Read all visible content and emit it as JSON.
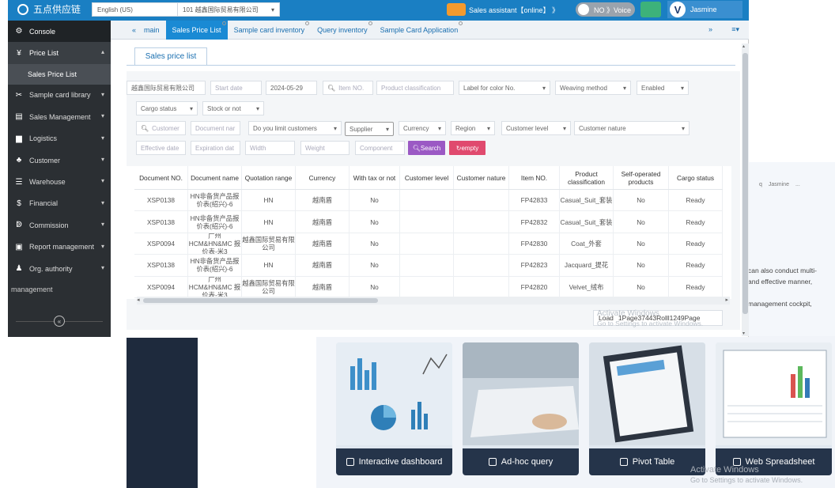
{
  "background": {
    "top_right": [
      "q",
      "Jasmine",
      "..."
    ],
    "text_lines": [
      "can also conduct multi-",
      "and effective manner,",
      "management cockpit,"
    ],
    "cards": [
      {
        "label": "Interactive dashboard",
        "icon": "dashboard-icon"
      },
      {
        "label": "Ad-hoc query",
        "icon": "query-icon"
      },
      {
        "label": "Pivot Table",
        "icon": "pivot-icon"
      },
      {
        "label": "Web Spreadsheet",
        "icon": "spreadsheet-icon"
      }
    ],
    "activate_title": "Activate Windows",
    "activate_sub": "Go to Settings to activate Windows."
  },
  "topbar": {
    "brand": "五点供应链",
    "language": "English (US)",
    "company": "101 越鑫国际贸易有限公司",
    "assistant": "Sales assistant【online】 》",
    "voice": "NO 》Voice",
    "user": "Jasmine",
    "avatar_letter": "V"
  },
  "sidebar": {
    "console": "Console",
    "items": [
      {
        "label": "Price List",
        "icon": "¥"
      },
      {
        "label": "Sample card library",
        "icon": "✂"
      },
      {
        "label": "Sales Management",
        "icon": "▤"
      },
      {
        "label": "Logistics",
        "icon": "▆"
      },
      {
        "label": "Customer",
        "icon": "♣"
      },
      {
        "label": "Warehouse",
        "icon": "☰"
      },
      {
        "label": "Financial",
        "icon": "$"
      },
      {
        "label": "Commission",
        "icon": "ↁ"
      },
      {
        "label": "Report management",
        "icon": "▣"
      },
      {
        "label": "Org. authority",
        "icon": "♟"
      }
    ],
    "sub_item": "Sales Price List",
    "continued": "management",
    "collapse_glyph": "«"
  },
  "tabs": {
    "back_glyph": "«",
    "main": "main",
    "items": [
      "Sales Price List",
      "Sample card inventory",
      "Query inventory",
      "Sample Card Application"
    ],
    "next_glyph": "»",
    "menu_glyph": "≡▾"
  },
  "subtab": "Sales price list",
  "filters": {
    "company": "越鑫国际贸易有限公司",
    "start_date": "Start date",
    "end_date": "2024-05-29",
    "item_no": "Item NO.",
    "product_classification": "Product classification",
    "label_color": "Label for color No.",
    "weaving_method": "Weaving method",
    "enabled": "Enabled",
    "cargo_status": "Cargo status",
    "stock": "Stock or not",
    "customer": "Customer",
    "document_name": "Document nar",
    "limit_customers": "Do you limit customers",
    "supplier": "Supplier",
    "currency": "Currency",
    "region": "Region",
    "customer_level": "Customer level",
    "customer_nature": "Customer nature",
    "effective_date": "Effective date",
    "expiration_date": "Expiration dat",
    "width": "Width",
    "weight": "Weight",
    "component": "Component",
    "search_btn": "Search",
    "empty_btn": "empty"
  },
  "table": {
    "columns": [
      "Document NO.",
      "Document name",
      "Quotation range",
      "Currency",
      "With tax or not",
      "Customer level",
      "Customer nature",
      "Item NO.",
      "Product classification",
      "Self-operated products",
      "Cargo status"
    ],
    "rows": [
      [
        "XSP0138",
        "HN非备货产品报价表(绍兴)-6",
        "HN",
        "越南盾",
        "No",
        "",
        "",
        "FP42833",
        "Casual_Suit_套装",
        "No",
        "Ready"
      ],
      [
        "XSP0138",
        "HN非备货产品报价表(绍兴)-6",
        "HN",
        "越南盾",
        "No",
        "",
        "",
        "FP42832",
        "Casual_Suit_套装",
        "No",
        "Ready"
      ],
      [
        "XSP0094",
        "广州HCM&HN&MC 报价表-米3",
        "越鑫国际贸易有限公司",
        "越南盾",
        "No",
        "",
        "",
        "FP42830",
        "Coat_外套",
        "No",
        "Ready"
      ],
      [
        "XSP0138",
        "HN非备货产品报价表(绍兴)-6",
        "HN",
        "越南盾",
        "No",
        "",
        "",
        "FP42823",
        "Jacquard_提花",
        "No",
        "Ready"
      ],
      [
        "XSP0094",
        "广州HCM&HN&MC 报价表-米3",
        "越鑫国际贸易有限公司",
        "越南盾",
        "No",
        "",
        "",
        "FP42820",
        "Velvet_绒布",
        "No",
        "Ready"
      ]
    ]
  },
  "pager": {
    "text": "Load",
    "info": "1Page37443Rolll1249Page"
  },
  "colors": {
    "topbar": "#1a7fc3",
    "sidebar": "#2b2f33",
    "active_tab": "#1a8ad4",
    "search": "#9b59c4",
    "empty": "#e04a6e"
  }
}
